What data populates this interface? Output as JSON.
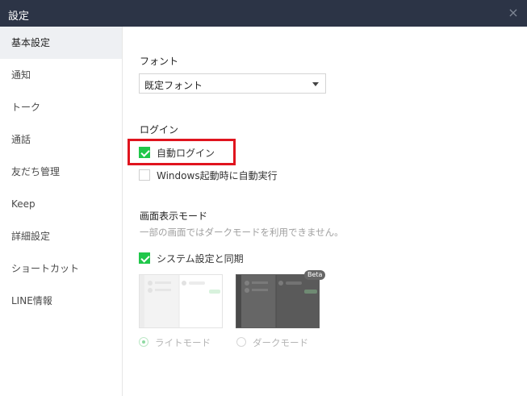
{
  "window": {
    "title": "設定",
    "close_glyph": "×"
  },
  "sidebar": {
    "items": [
      {
        "label": "基本設定"
      },
      {
        "label": "通知"
      },
      {
        "label": "トーク"
      },
      {
        "label": "通話"
      },
      {
        "label": "友だち管理"
      },
      {
        "label": "Keep"
      },
      {
        "label": "詳細設定"
      },
      {
        "label": "ショートカット"
      },
      {
        "label": "LINE情報"
      }
    ],
    "active_index": 0
  },
  "font_section": {
    "label": "フォント",
    "selected": "既定フォント"
  },
  "login_section": {
    "label": "ログイン",
    "auto_login": {
      "label": "自動ログイン",
      "checked": true
    },
    "auto_start": {
      "label": "Windows起動時に自動実行",
      "checked": false
    }
  },
  "display_section": {
    "label": "画面表示モード",
    "note": "一部の画面ではダークモードを利用できません。",
    "sync_system": {
      "label": "システム設定と同期",
      "checked": true
    },
    "beta_badge": "Beta",
    "light_mode": {
      "label": "ライトモード",
      "selected": true
    },
    "dark_mode": {
      "label": "ダークモード",
      "selected": false
    }
  },
  "colors": {
    "titlebar": "#2c3446",
    "check_green": "#20c74a",
    "highlight_red": "#e0141e",
    "sidebar_active": "#eef0f3"
  }
}
